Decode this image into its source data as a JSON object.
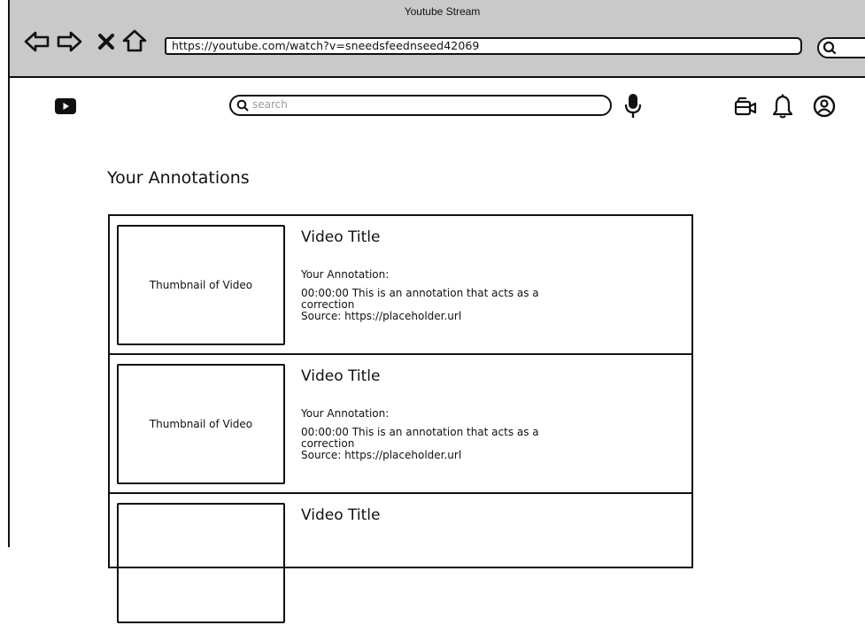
{
  "browser": {
    "title": "Youtube Stream",
    "url": "https://youtube.com/watch?v=sneedsfeednseed42069"
  },
  "header": {
    "search_placeholder": "search"
  },
  "section": {
    "title": "Your Annotations"
  },
  "annotations": [
    {
      "thumbnail_label": "Thumbnail of Video",
      "video_title": "Video Title",
      "label": "Your Annotation:",
      "text": "00:00:00 This is an annotation that acts as a correction",
      "source": "Source: https://placeholder.url"
    },
    {
      "thumbnail_label": "Thumbnail of Video",
      "video_title": "Video Title",
      "label": "Your Annotation:",
      "text": "00:00:00 This is an annotation that acts as a correction",
      "source": "Source: https://placeholder.url"
    },
    {
      "thumbnail_label": "",
      "video_title": "Video Title",
      "label": "",
      "text": "",
      "source": ""
    }
  ],
  "icons": {
    "back": "arrow-left-icon",
    "forward": "arrow-right-icon",
    "stop": "close-icon",
    "home": "home-icon",
    "logo": "youtube-logo-icon",
    "mic": "microphone-icon",
    "create": "video-camera-icon",
    "notifications": "bell-icon",
    "account": "user-circle-icon"
  }
}
